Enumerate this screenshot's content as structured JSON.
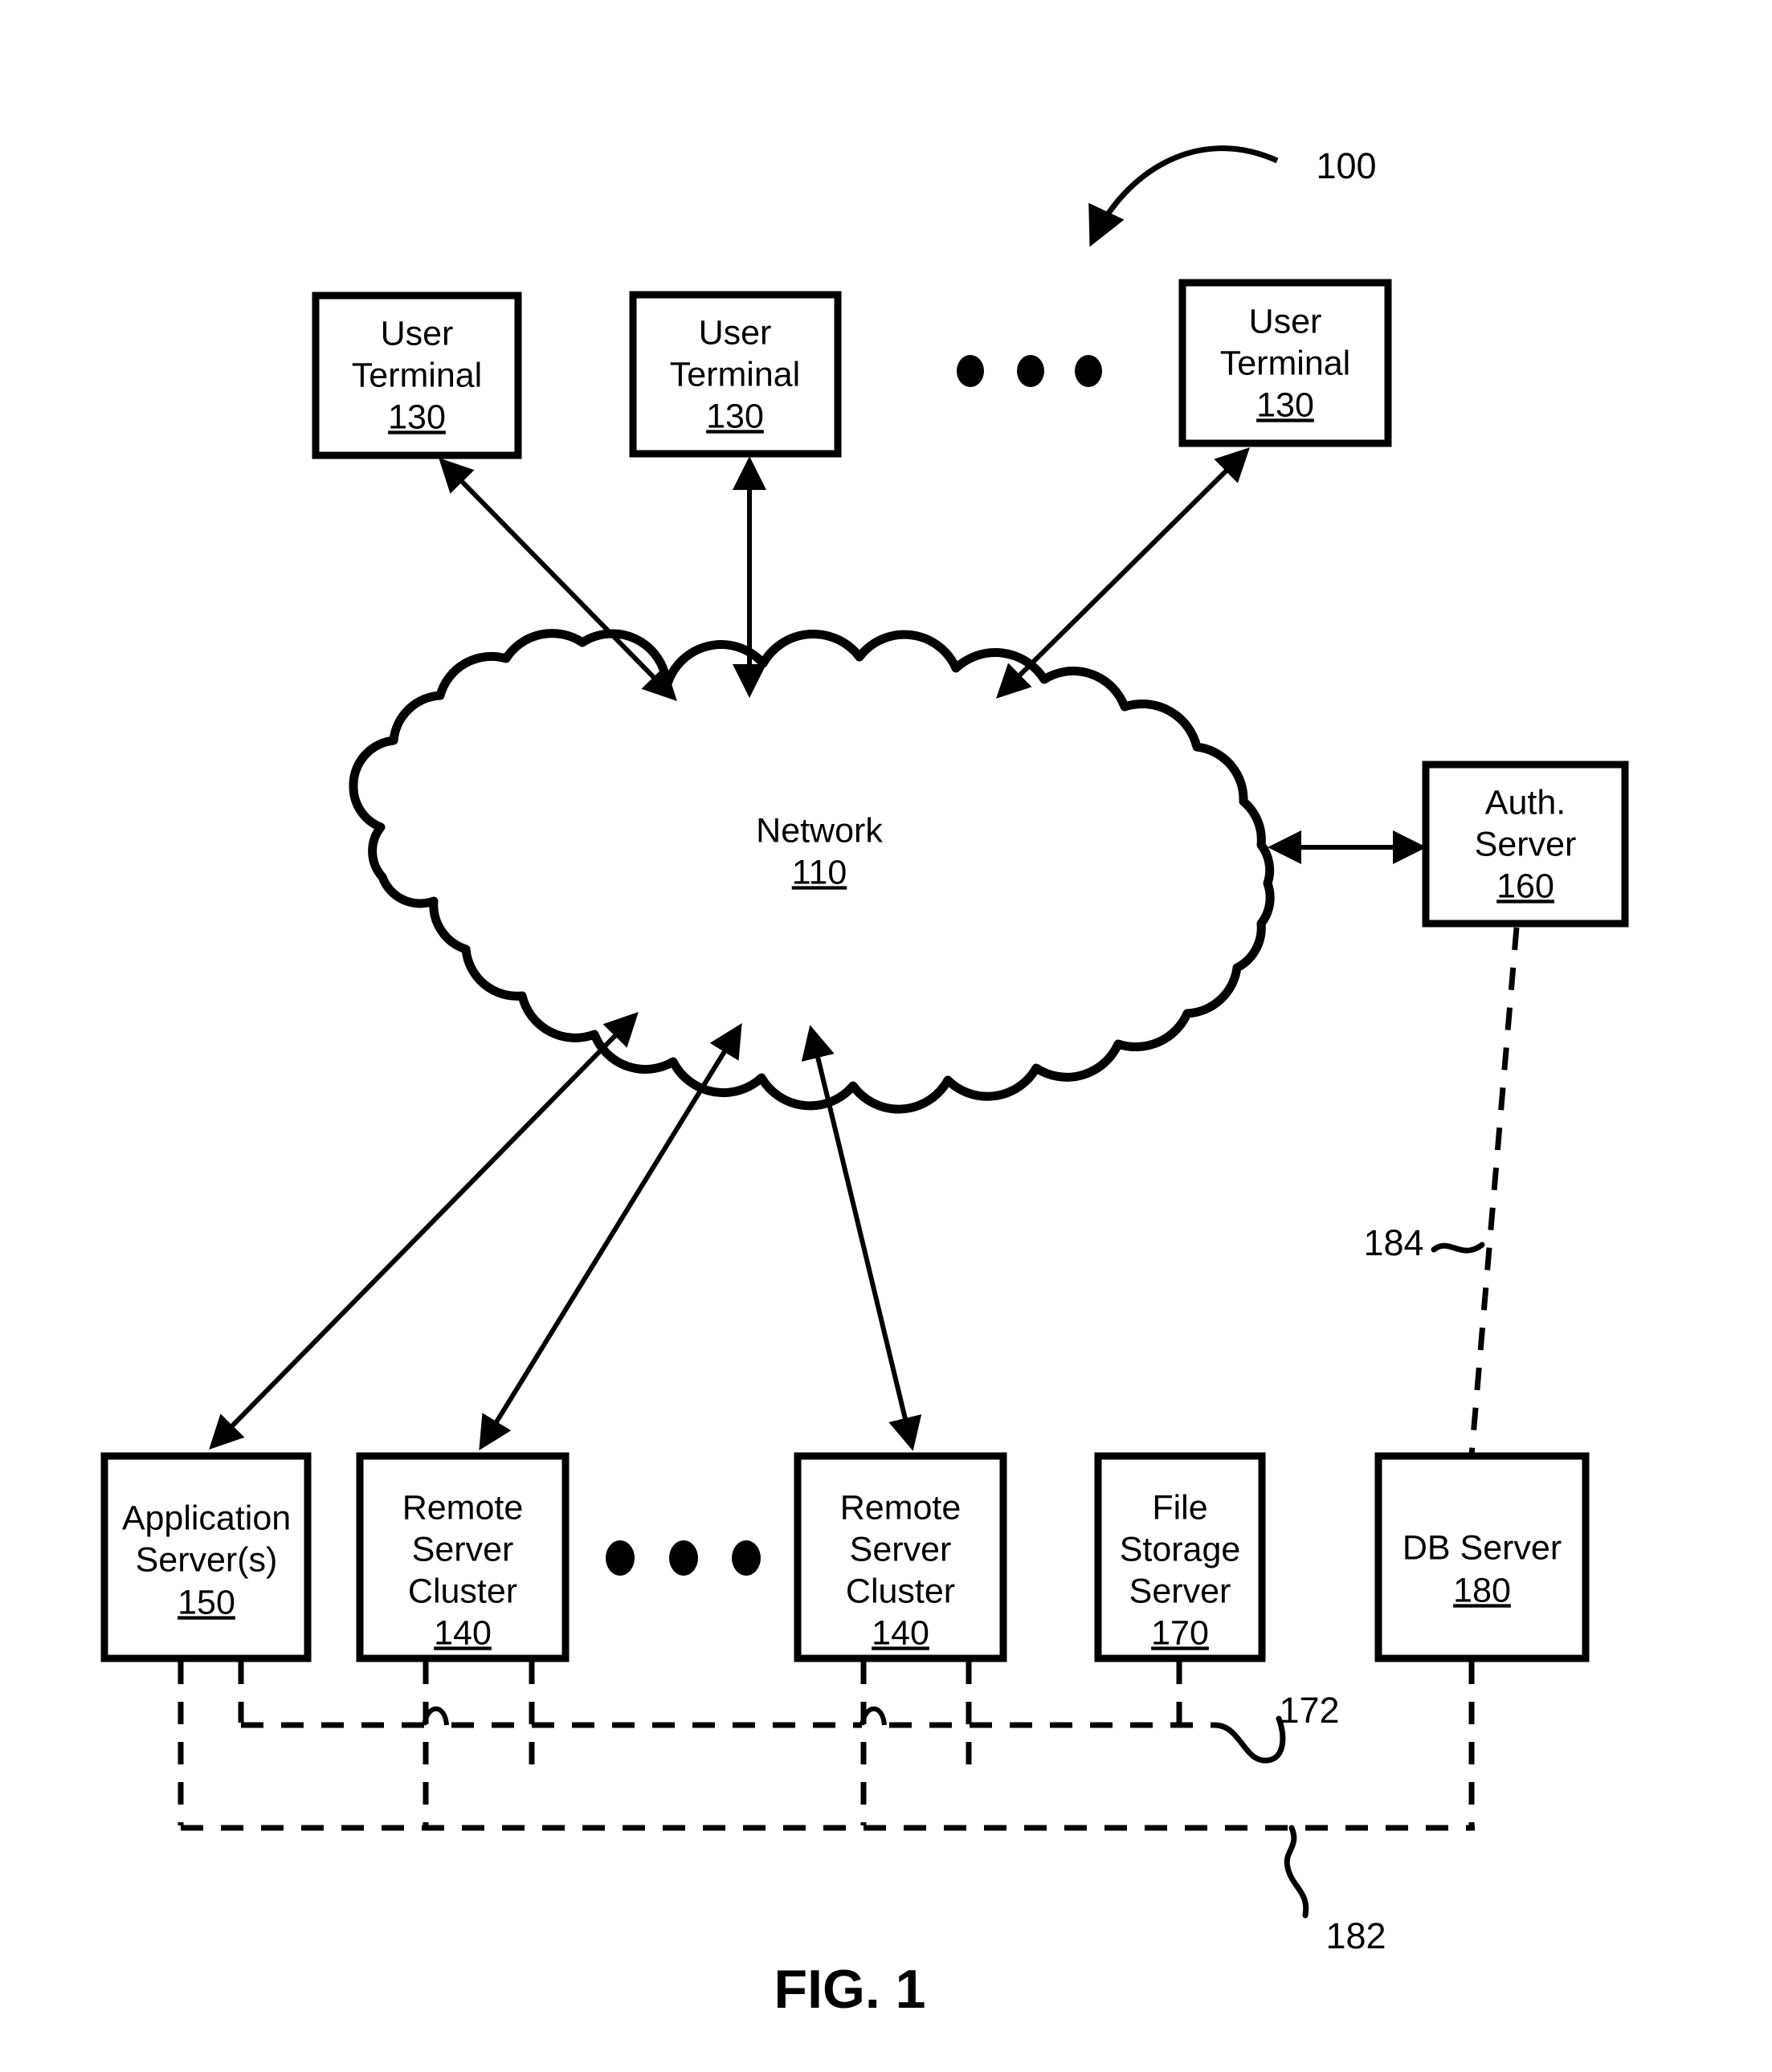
{
  "figure": {
    "caption": "FIG. 1",
    "system_ref": "100"
  },
  "nodes": {
    "user_terminal_1": {
      "line1": "User",
      "line2": "Terminal",
      "ref": "130"
    },
    "user_terminal_2": {
      "line1": "User",
      "line2": "Terminal",
      "ref": "130"
    },
    "user_terminal_n": {
      "line1": "User",
      "line2": "Terminal",
      "ref": "130"
    },
    "network": {
      "line1": "Network",
      "ref": "110"
    },
    "auth_server": {
      "line1": "Auth.",
      "line2": "Server",
      "ref": "160"
    },
    "application_server": {
      "line1": "Application",
      "line2": "Server(s)",
      "ref": "150"
    },
    "remote_server_cluster_1": {
      "line1": "Remote",
      "line2": "Server",
      "line3": "Cluster",
      "ref": "140"
    },
    "remote_server_cluster_n": {
      "line1": "Remote",
      "line2": "Server",
      "line3": "Cluster",
      "ref": "140"
    },
    "file_storage_server": {
      "line1": "File",
      "line2": "Storage",
      "line3": "Server",
      "ref": "170"
    },
    "db_server": {
      "line1": "DB Server",
      "ref": "180"
    }
  },
  "connection_refs": {
    "file_storage_bus": "172",
    "db_bus": "182",
    "auth_db_link": "184"
  },
  "colors": {
    "stroke": "#000000",
    "fill": "#ffffff",
    "background": "#ffffff"
  }
}
